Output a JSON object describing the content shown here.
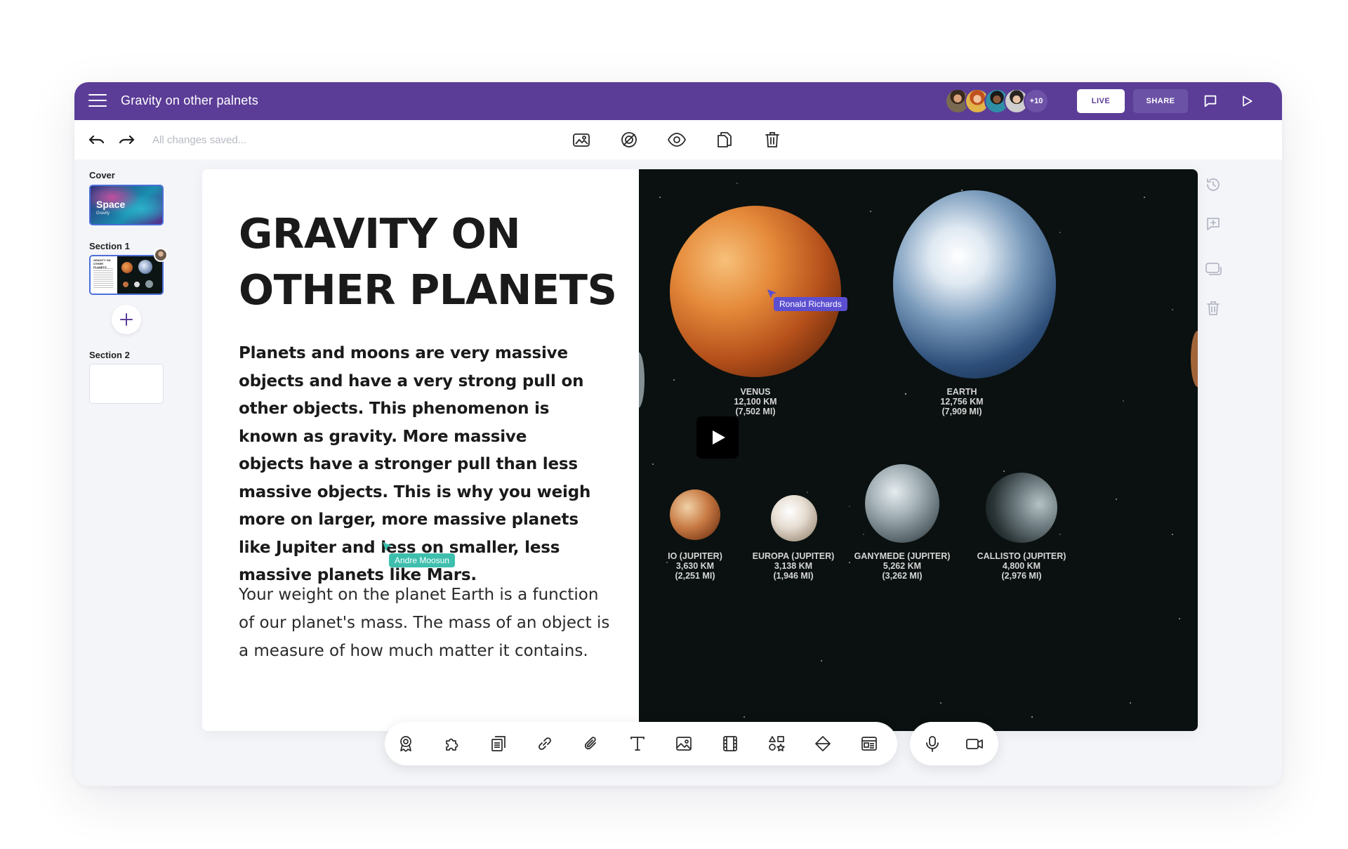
{
  "header": {
    "title": "Gravity on other palnets",
    "collaborators_more": "+10",
    "live_label": "LIVE",
    "share_label": "SHARE",
    "icons": [
      "menu-icon",
      "comment-icon",
      "play-icon"
    ]
  },
  "toolbar": {
    "status": "All changes saved...",
    "icons": [
      "undo-icon",
      "redo-icon",
      "image-icon",
      "hide-icon",
      "preview-icon",
      "duplicate-icon",
      "delete-icon"
    ]
  },
  "sidebar": {
    "sections": [
      {
        "label": "Cover",
        "thumb_title": "Space",
        "thumb_subtitle": "Gravity"
      },
      {
        "label": "Section 1",
        "thumb_title": "GRAVITY ON OTHER PLANETS"
      },
      {
        "label": "Section 2"
      }
    ],
    "add_icon": "plus-icon"
  },
  "slide": {
    "title_line1": "GRAVITY ON",
    "title_line2": "OTHER PLANETS",
    "bold_paragraph": "Planets and moons are very massive objects and have a very strong pull on other objects. This phenomenon is known as gravity. More massive objects have a stronger pull than less massive objects. This is why you weigh more on larger, more massive planets like Jupiter and less on smaller, less massive planets like Mars.",
    "normal_paragraph": "Your weight on the planet Earth is a function of our planet's mass. The mass of an object is a measure of how much matter it contains.",
    "cursors": [
      {
        "name": "Andre Moosun",
        "color": "#3ebfae"
      },
      {
        "name": "Ronald Richards",
        "color": "#5b4fd0"
      }
    ],
    "planets": [
      {
        "name": "VENUS",
        "l2": "12,100 KM",
        "l3": "(7,502 MI)"
      },
      {
        "name": "EARTH",
        "l2": "12,756 KM",
        "l3": "(7,909 MI)"
      },
      {
        "name": "IO (JUPITER)",
        "l2": "3,630 KM",
        "l3": "(2,251 MI)"
      },
      {
        "name": "EUROPA (JUPITER)",
        "l2": "3,138 KM",
        "l3": "(1,946 MI)"
      },
      {
        "name": "GANYMEDE (JUPITER)",
        "l2": "5,262 KM",
        "l3": "(3,262 MI)"
      },
      {
        "name": "CALLISTO (JUPITER)",
        "l2": "4,800 KM",
        "l3": "(2,976 MI)"
      }
    ]
  },
  "right_rail": {
    "icons": [
      "history-icon",
      "add-comment-icon",
      "slides-icon",
      "trash-icon"
    ]
  },
  "bottom_toolbar": {
    "icons": [
      "award-icon",
      "puzzle-icon",
      "pages-icon",
      "link-icon",
      "attach-icon",
      "text-icon",
      "image-icon",
      "film-icon",
      "shapes-icon",
      "fill-icon",
      "layout-icon",
      "mic-icon",
      "video-icon"
    ]
  }
}
